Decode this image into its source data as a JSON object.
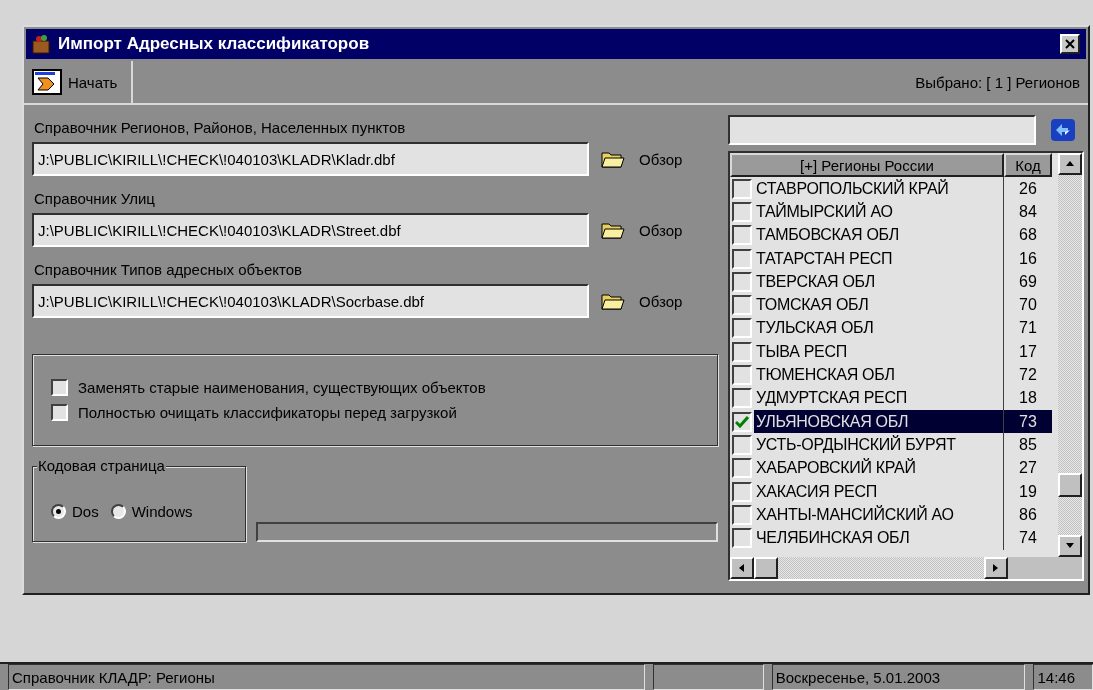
{
  "window": {
    "title": "Импорт Адресных классификаторов"
  },
  "toolbar": {
    "start_label": "Начать",
    "selection_info": "Выбрано: [ 1 ] Регионов"
  },
  "files": [
    {
      "label": "Справочник Регионов, Районов, Населенных пунктов",
      "value": "J:\\PUBLIC\\KIRILL\\!CHECK\\!040103\\KLADR\\Kladr.dbf",
      "browse": "Обзор"
    },
    {
      "label": "Справочник Улиц",
      "value": "J:\\PUBLIC\\KIRILL\\!CHECK\\!040103\\KLADR\\Street.dbf",
      "browse": "Обзор"
    },
    {
      "label": "Справочник Типов адресных объектов",
      "value": "J:\\PUBLIC\\KIRILL\\!CHECK\\!040103\\KLADR\\Socrbase.dbf",
      "browse": "Обзор"
    }
  ],
  "options": [
    {
      "label": "Заменять старые наименования, существующих объектов",
      "checked": false
    },
    {
      "label": "Полностью очищать классификаторы перед загрузкой",
      "checked": false
    }
  ],
  "codepage": {
    "title": "Кодовая страница",
    "options": [
      {
        "label": "Dos",
        "selected": true
      },
      {
        "label": "Windows",
        "selected": false
      }
    ]
  },
  "region_list": {
    "columns": [
      "[+] Регионы России",
      "Код"
    ],
    "rows": [
      {
        "name": "СТАВРОПОЛЬСКИЙ КРАЙ",
        "code": "26",
        "checked": false,
        "selected": false
      },
      {
        "name": "ТАЙМЫРСКИЙ АО",
        "code": "84",
        "checked": false,
        "selected": false
      },
      {
        "name": "ТАМБОВСКАЯ ОБЛ",
        "code": "68",
        "checked": false,
        "selected": false
      },
      {
        "name": "ТАТАРСТАН РЕСП",
        "code": "16",
        "checked": false,
        "selected": false
      },
      {
        "name": "ТВЕРСКАЯ ОБЛ",
        "code": "69",
        "checked": false,
        "selected": false
      },
      {
        "name": "ТОМСКАЯ ОБЛ",
        "code": "70",
        "checked": false,
        "selected": false
      },
      {
        "name": "ТУЛЬСКАЯ ОБЛ",
        "code": "71",
        "checked": false,
        "selected": false
      },
      {
        "name": "ТЫВА РЕСП",
        "code": "17",
        "checked": false,
        "selected": false
      },
      {
        "name": "ТЮМЕНСКАЯ ОБЛ",
        "code": "72",
        "checked": false,
        "selected": false
      },
      {
        "name": "УДМУРТСКАЯ РЕСП",
        "code": "18",
        "checked": false,
        "selected": false
      },
      {
        "name": "УЛЬЯНОВСКАЯ ОБЛ",
        "code": "73",
        "checked": true,
        "selected": true
      },
      {
        "name": "УСТЬ-ОРДЫНСКИЙ БУРЯТ",
        "code": "85",
        "checked": false,
        "selected": false
      },
      {
        "name": "ХАБАРОВСКИЙ КРАЙ",
        "code": "27",
        "checked": false,
        "selected": false
      },
      {
        "name": "ХАКАСИЯ РЕСП",
        "code": "19",
        "checked": false,
        "selected": false
      },
      {
        "name": "ХАНТЫ-МАНСИЙСКИЙ АО",
        "code": "86",
        "checked": false,
        "selected": false
      },
      {
        "name": "ЧЕЛЯБИНСКАЯ ОБЛ",
        "code": "74",
        "checked": false,
        "selected": false
      }
    ]
  },
  "status_bar": {
    "message": "Справочник КЛАДР: Регионы",
    "date": "Воскресенье, 5.01.2003",
    "time": "14:46"
  }
}
